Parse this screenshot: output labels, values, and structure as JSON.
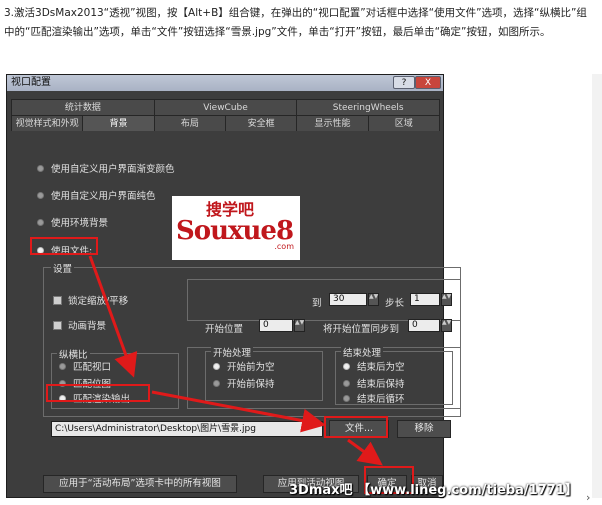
{
  "instruction": "3.激活3DsMax2013“透视”视图，按【Alt+B】组合键，在弹出的“视口配置”对话框中选择“使用文件”选项，选择“纵横比”组中的“匹配渲染输出”选项，单击“文件”按钮选择“雪景.jpg”文件，单击“打开”按钮，最后单击“确定”按钮，如图所示。",
  "dialog": {
    "title": "视口配置",
    "help_label": "?",
    "close_label": "X",
    "tabs_row1": [
      "统计数据",
      "ViewCube",
      "SteeringWheels"
    ],
    "tabs_row2": [
      "视觉样式和外观",
      "背景",
      "布局",
      "安全框",
      "显示性能",
      "区域"
    ],
    "active_tab": "背景",
    "bg_options": [
      "使用自定义用户界面渐变颜色",
      "使用自定义用户界面纯色",
      "使用环境背景",
      "使用文件:"
    ],
    "selected_bg_option": "使用文件:",
    "settings_label": "设置",
    "lock_zoom_label": "锁定缩放/平移",
    "animate_bg_label": "动画背景",
    "aspect_group_label": "纵横比",
    "aspect_options": [
      "匹配视口",
      "匹配位图",
      "匹配渲染输出"
    ],
    "selected_aspect": "匹配渲染输出",
    "frame_end_label": "到",
    "frame_end_value": "30",
    "step_label": "步长",
    "step_value": "1",
    "start_pos_label": "开始位置",
    "start_pos_value": "0",
    "sync_label": "将开始位置同步到",
    "sync_value": "0",
    "start_group_label": "开始处理",
    "start_options": [
      "开始前为空",
      "开始前保持"
    ],
    "end_group_label": "结束处理",
    "end_options": [
      "结束后为空",
      "结束后保持",
      "结束后循环"
    ],
    "file_path": "C:\\Users\\Administrator\\Desktop\\图片\\雪景.jpg",
    "file_button": "文件...",
    "remove_button": "移除",
    "apply_all_button": "应用于“活动布局”选项卡中的所有视图",
    "apply_active_button": "应用到活动视图",
    "ok_button": "确定",
    "cancel_button": "取消"
  },
  "logo": {
    "line1": "搜学吧",
    "line2": "Souxue8",
    "line3": ".com"
  },
  "watermark": "3Dmax吧 【www.lineg.com/tieba/1771】",
  "colors": {
    "dialog_bg": "#3d3d3d",
    "annotation_red": "#e01a1a"
  }
}
